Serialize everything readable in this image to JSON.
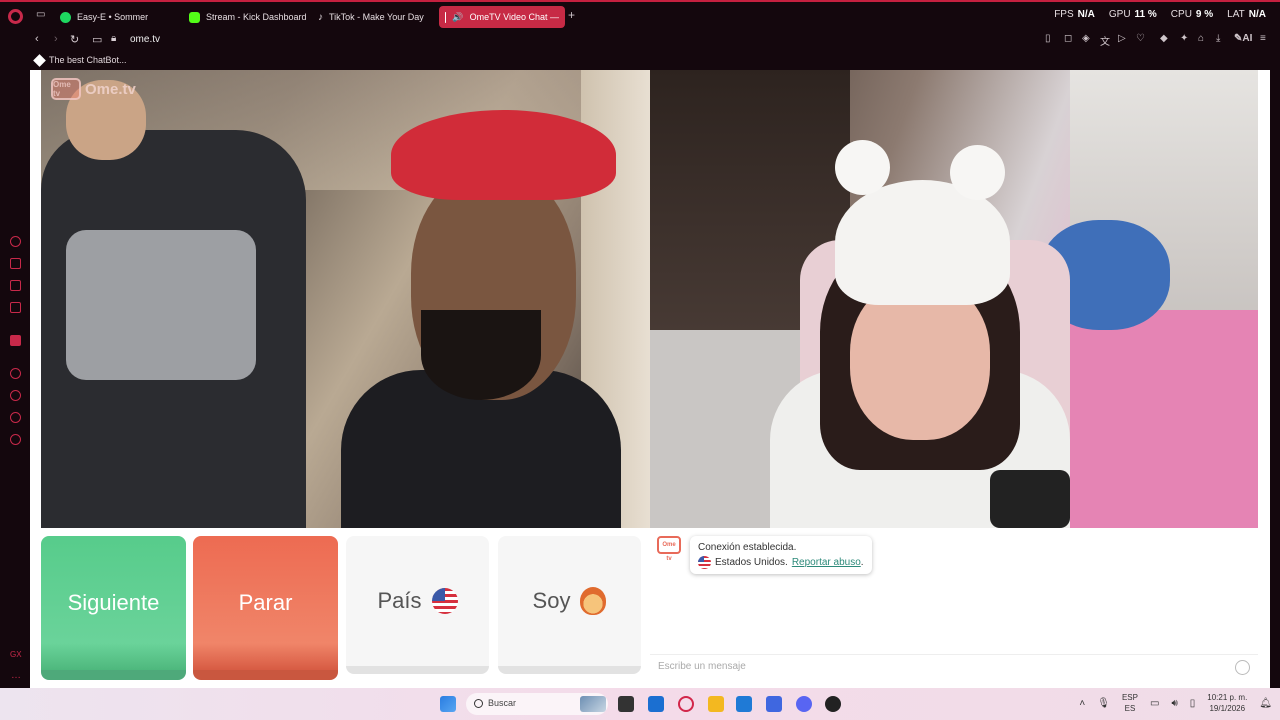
{
  "tabs": [
    {
      "label": "Easy-E • Sommer",
      "icon": "spotify-icon",
      "active": false
    },
    {
      "label": "Stream - Kick Dashboard",
      "icon": "kick-icon",
      "active": false
    },
    {
      "label": "TikTok - Make Your Day",
      "icon": "tiktok-icon",
      "active": false
    },
    {
      "label": "OmeTV Video Chat —",
      "icon": "ometv-icon",
      "active": true
    }
  ],
  "stats": {
    "fps_label": "FPS",
    "fps_value": "N/A",
    "gpu_label": "GPU",
    "gpu_value": "11 %",
    "cpu_label": "CPU",
    "cpu_value": "9 %",
    "lat_label": "LAT",
    "lat_value": "N/A"
  },
  "address": {
    "url": "ome.tv",
    "ai_label": "AI"
  },
  "bookmarks": [
    {
      "label": "The best ChatBot..."
    }
  ],
  "watermark": {
    "badge": "Ome tv",
    "text": "Ome.tv"
  },
  "buttons": {
    "next": "Siguiente",
    "stop": "Parar",
    "country": "País",
    "gender": "Soy"
  },
  "chat": {
    "logo": "Ome tv",
    "status": "Conexión establecida.",
    "country": "Estados Unidos.",
    "report": "Reportar abuso",
    "report_suffix": ".",
    "input_placeholder": "Escribe un mensaje"
  },
  "taskbar": {
    "search_placeholder": "Buscar",
    "lang_top": "ESP",
    "lang_bottom": "ES",
    "time": "10:21 p. m.",
    "date": "19/1/2026"
  },
  "colors": {
    "accent": "#c72a45",
    "next": "#5ccf8e",
    "stop": "#ee7158",
    "link": "#2d8a7a"
  }
}
